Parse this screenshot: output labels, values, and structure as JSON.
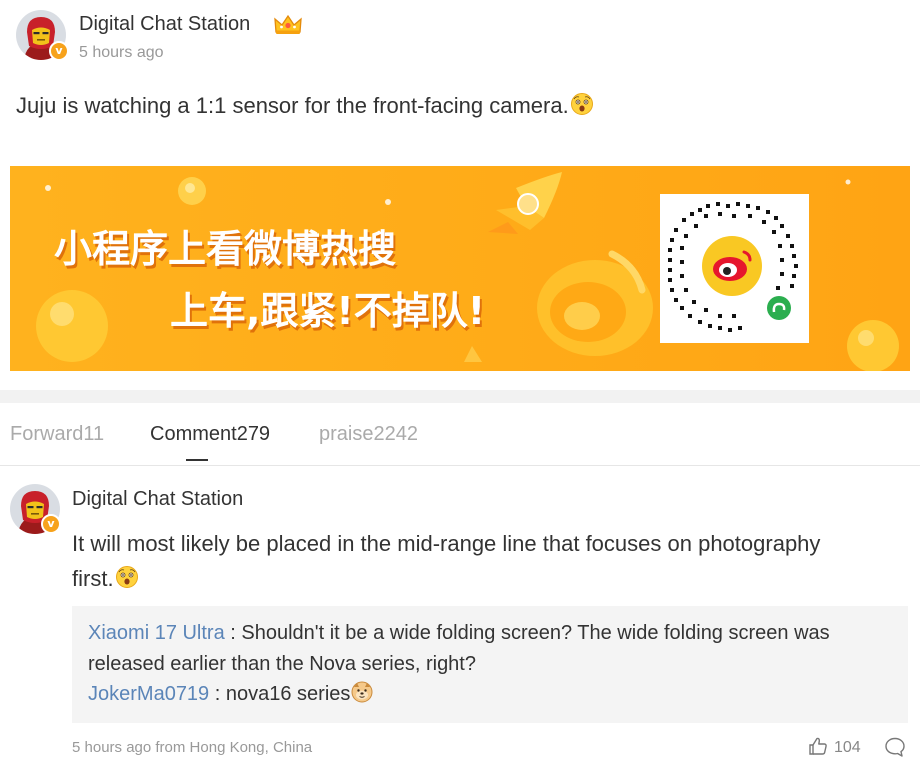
{
  "post": {
    "author": "Digital Chat Station",
    "time": "5 hours ago",
    "text": "Juju is watching a 1:1 sensor for the front-facing camera.",
    "avatar_icon": "iron-man-avatar-icon",
    "badge_icon": "verified-v-icon",
    "crown_icon": "crown-icon",
    "text_emoji": "surprised-face-icon"
  },
  "banner": {
    "line1": "小程序上看微博热搜",
    "line2": "上车,跟紧!不掉队!",
    "background_color": "#ffab18",
    "qr_icon": "weibo-qr-code-icon"
  },
  "tabs": [
    {
      "label": "Forward11"
    },
    {
      "label": "Comment279"
    },
    {
      "label": "praise2242"
    }
  ],
  "comment": {
    "author": "Digital Chat Station",
    "text": "It will most likely be placed in the mid-range line that focuses on photography first.",
    "text_emoji": "surprised-face-icon",
    "replies": [
      {
        "user": "Xiaomi 17 Ultra",
        "separator": " : ",
        "text": "Shouldn't it be a wide folding screen? The wide folding screen was released earlier than the Nova series, right?"
      },
      {
        "user": "JokerMa0719",
        "separator": " : ",
        "text": "nova16 series",
        "emoji": "doge-face-icon"
      }
    ],
    "meta": "5 hours ago from Hong Kong, China",
    "like_count": "104"
  },
  "colors": {
    "link": "#5b85b8",
    "muted": "#999999",
    "text": "#333333",
    "badge": "#f7a21b",
    "banner": "#ffab18"
  }
}
